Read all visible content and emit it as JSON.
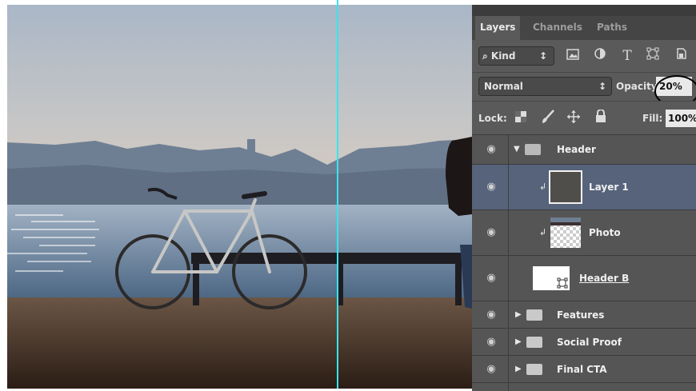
{
  "colors": {
    "guide": "#37e6ee",
    "panel_bg": "#535353",
    "selected_layer": "#56637b",
    "input_bg": "#e9e9e9"
  },
  "layers_panel": {
    "tabs": [
      "Layers",
      "Channels",
      "Paths"
    ],
    "filter": {
      "kind_label": "⌕ Kind",
      "kind_arrow": "↕",
      "filter_icons": [
        "image-filter-icon",
        "adjustment-filter-icon",
        "type-filter-icon",
        "shape-filter-icon",
        "smart-object-filter-icon"
      ],
      "type_glyph": "T"
    },
    "blend_mode": "Normal",
    "blend_arrow": "↕",
    "opacity_label": "Opacity:",
    "opacity_value": "20%",
    "lock_label": "Lock:",
    "fill_label": "Fill:",
    "fill_value": "100%",
    "layers": [
      {
        "name": "Header",
        "kind": "group",
        "expanded": true
      },
      {
        "name": "Layer 1",
        "kind": "pixel",
        "selected": true,
        "clipped": true
      },
      {
        "name": "Photo",
        "kind": "pixel",
        "clipped": true
      },
      {
        "name": "Header B",
        "kind": "shape"
      },
      {
        "name": "Features",
        "kind": "group",
        "expanded": false
      },
      {
        "name": "Social Proof",
        "kind": "group",
        "expanded": false
      },
      {
        "name": "Final CTA",
        "kind": "group",
        "expanded": false
      }
    ],
    "eye_glyph": "◉"
  }
}
